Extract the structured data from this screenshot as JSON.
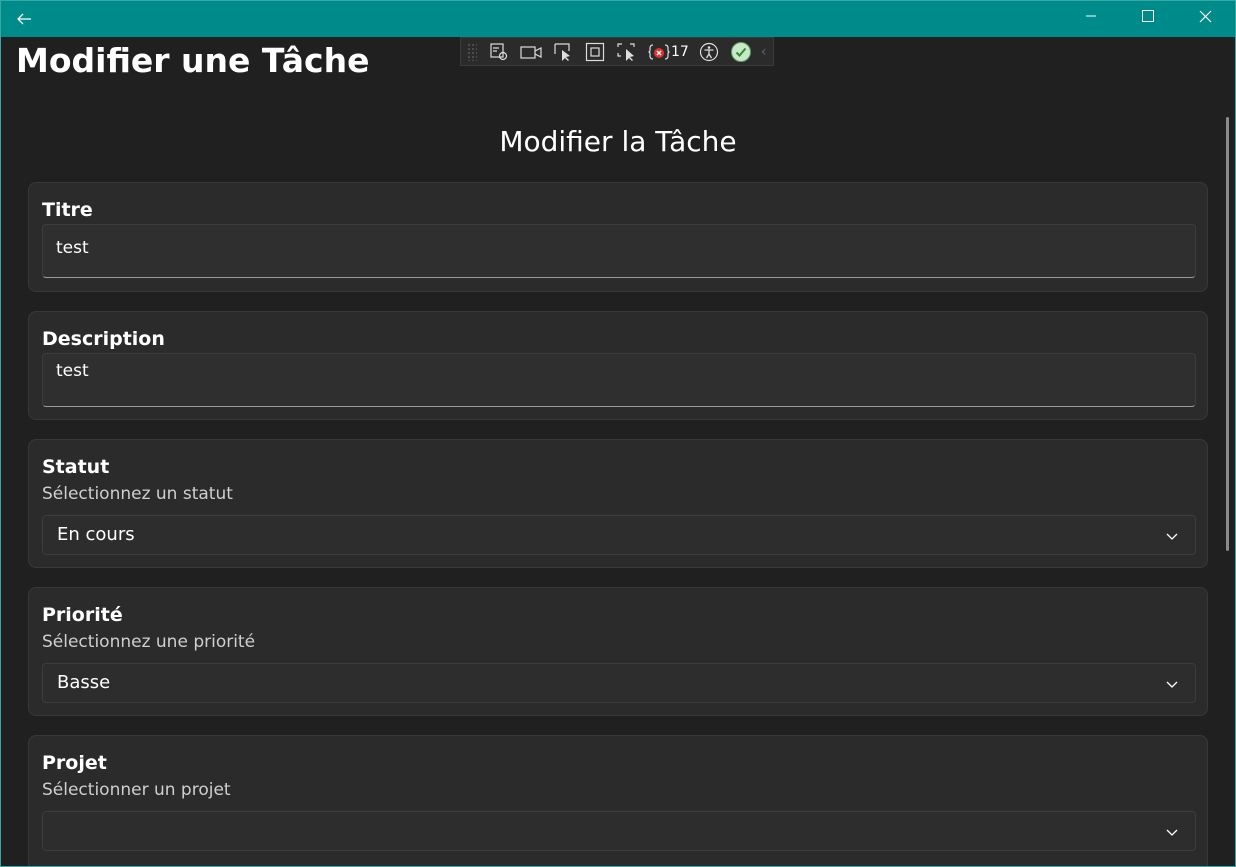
{
  "page": {
    "title": "Modifier une Tâche",
    "form_title": "Modifier la Tâche"
  },
  "devtools": {
    "error_count": "17"
  },
  "fields": {
    "title": {
      "label": "Titre",
      "value": "test"
    },
    "description": {
      "label": "Description",
      "value": "test"
    },
    "status": {
      "label": "Statut",
      "hint": "Sélectionnez un statut",
      "selected": "En cours"
    },
    "priority": {
      "label": "Priorité",
      "hint": "Sélectionnez une priorité",
      "selected": "Basse"
    },
    "project": {
      "label": "Projet",
      "hint": "Sélectionner un projet",
      "selected": ""
    }
  },
  "colors": {
    "titlebar": "#008b8b",
    "background": "#202020",
    "card": "#2b2b2b"
  },
  "icons": [
    "back-arrow-icon",
    "minimize-icon",
    "maximize-icon",
    "close-icon",
    "chevron-down-icon"
  ]
}
